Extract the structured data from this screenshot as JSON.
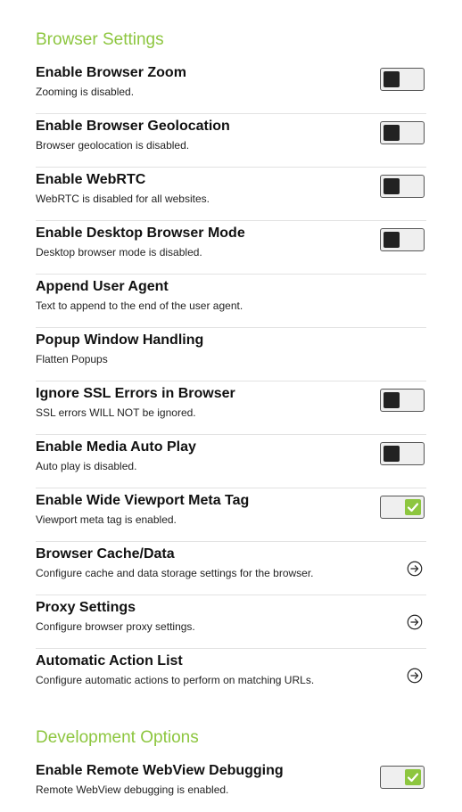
{
  "sections": [
    {
      "title": "Browser Settings"
    },
    {
      "title": "Development Options"
    }
  ],
  "items": [
    {
      "title": "Enable Browser Zoom",
      "subtitle": "Zooming is disabled.",
      "control": "toggle",
      "checked": false
    },
    {
      "title": "Enable Browser Geolocation",
      "subtitle": "Browser geolocation is disabled.",
      "control": "toggle",
      "checked": false
    },
    {
      "title": "Enable WebRTC",
      "subtitle": "WebRTC is disabled for all websites.",
      "control": "toggle",
      "checked": false
    },
    {
      "title": "Enable Desktop Browser Mode",
      "subtitle": "Desktop browser mode is disabled.",
      "control": "toggle",
      "checked": false
    },
    {
      "title": "Append User Agent",
      "subtitle": "Text to append to the end of the user agent.",
      "control": "none"
    },
    {
      "title": "Popup Window Handling",
      "subtitle": "Flatten Popups",
      "control": "none"
    },
    {
      "title": "Ignore SSL Errors in Browser",
      "subtitle": "SSL errors WILL NOT be ignored.",
      "control": "toggle",
      "checked": false
    },
    {
      "title": "Enable Media Auto Play",
      "subtitle": "Auto play is disabled.",
      "control": "toggle",
      "checked": false
    },
    {
      "title": "Enable Wide Viewport Meta Tag",
      "subtitle": "Viewport meta tag is enabled.",
      "control": "toggle",
      "checked": true
    },
    {
      "title": "Browser Cache/Data",
      "subtitle": "Configure cache and data storage settings for the browser.",
      "control": "arrow"
    },
    {
      "title": "Proxy Settings",
      "subtitle": "Configure browser proxy settings.",
      "control": "arrow"
    },
    {
      "title": "Automatic Action List",
      "subtitle": "Configure automatic actions to perform on matching URLs.",
      "control": "arrow"
    },
    {
      "title": "Enable Remote WebView Debugging",
      "subtitle": "Remote WebView debugging is enabled.",
      "control": "toggle",
      "checked": true
    }
  ],
  "colors": {
    "accent": "#8dc63f",
    "knob_off": "#222222",
    "divider": "#e2e2e2"
  },
  "icons": {
    "arrow": "arrow-circle-right-icon",
    "check": "check-icon"
  }
}
